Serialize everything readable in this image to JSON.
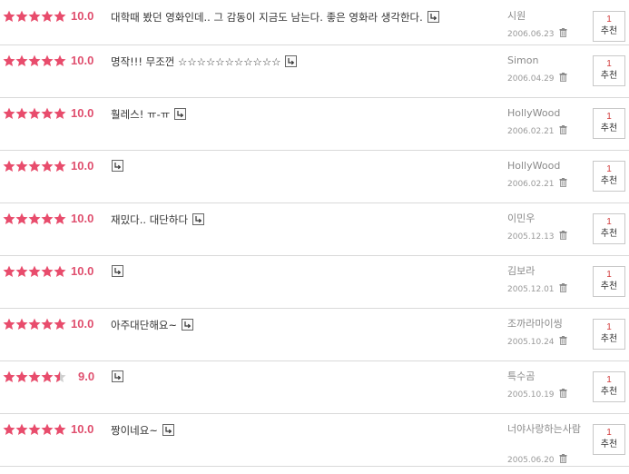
{
  "colors": {
    "star": "#e84c6c",
    "score": "#e0506f",
    "recommend_count": "#d23c3c"
  },
  "reviews": [
    {
      "stars": 5,
      "score": "10.0",
      "comment": "대학때 봤던 영화인데.. 그 감동이 지금도 남는다. 좋은 영화라 생각한다.",
      "author": "시원",
      "date": "2006.06.23",
      "recommend_count": "1",
      "recommend_label": "추천"
    },
    {
      "stars": 5,
      "score": "10.0",
      "comment": "명작!!! 무조껀 ☆☆☆☆☆☆☆☆☆☆☆",
      "author": "Simon",
      "date": "2006.04.29",
      "recommend_count": "1",
      "recommend_label": "추천"
    },
    {
      "stars": 5,
      "score": "10.0",
      "comment": "훨레스! ㅠ-ㅠ",
      "author": "HollyWood",
      "date": "2006.02.21",
      "recommend_count": "1",
      "recommend_label": "추천"
    },
    {
      "stars": 5,
      "score": "10.0",
      "comment": "",
      "author": "HollyWood",
      "date": "2006.02.21",
      "recommend_count": "1",
      "recommend_label": "추천"
    },
    {
      "stars": 5,
      "score": "10.0",
      "comment": "재밌다.. 대단하다",
      "author": "이민우",
      "date": "2005.12.13",
      "recommend_count": "1",
      "recommend_label": "추천"
    },
    {
      "stars": 5,
      "score": "10.0",
      "comment": "",
      "author": "김보라",
      "date": "2005.12.01",
      "recommend_count": "1",
      "recommend_label": "추천"
    },
    {
      "stars": 5,
      "score": "10.0",
      "comment": "아주대단해요~",
      "author": "조까라마이씽",
      "date": "2005.10.24",
      "recommend_count": "1",
      "recommend_label": "추천"
    },
    {
      "stars": 4.5,
      "score": "9.0",
      "comment": "",
      "author": "특수곰",
      "date": "2005.10.19",
      "recommend_count": "1",
      "recommend_label": "추천"
    },
    {
      "stars": 5,
      "score": "10.0",
      "comment": "짱이네요~",
      "author": "너야사랑하는사람",
      "date": "2005.06.20",
      "recommend_count": "1",
      "recommend_label": "추천"
    }
  ]
}
